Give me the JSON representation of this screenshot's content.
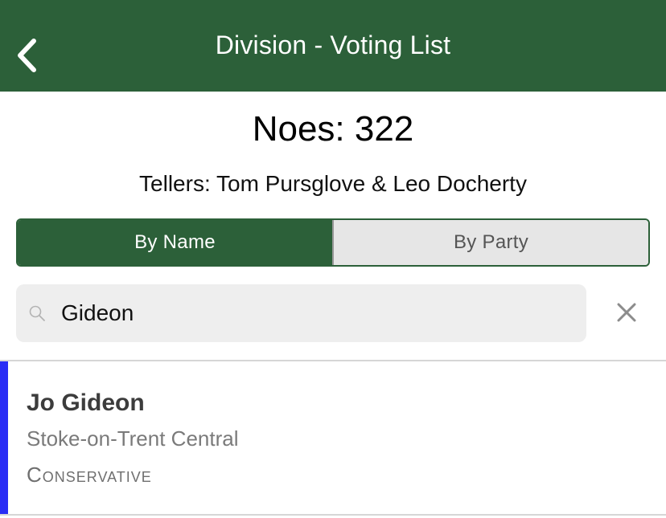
{
  "header": {
    "title": "Division - Voting List",
    "back_icon": "chevron-left-icon",
    "background": "#2c6039"
  },
  "summary": {
    "count_title": "Noes: 322",
    "tellers": "Tellers: Tom Pursglove & Leo Docherty"
  },
  "segmented_control": {
    "options": [
      {
        "label": "By Name",
        "selected": true
      },
      {
        "label": "By Party",
        "selected": false
      }
    ]
  },
  "search": {
    "value": "Gideon",
    "search_icon": "search-icon",
    "clear_icon": "close-icon"
  },
  "results": [
    {
      "name": "Jo Gideon",
      "constituency": "Stoke-on-Trent Central",
      "party": "Conservative",
      "party_color": "#2a2df5"
    }
  ]
}
